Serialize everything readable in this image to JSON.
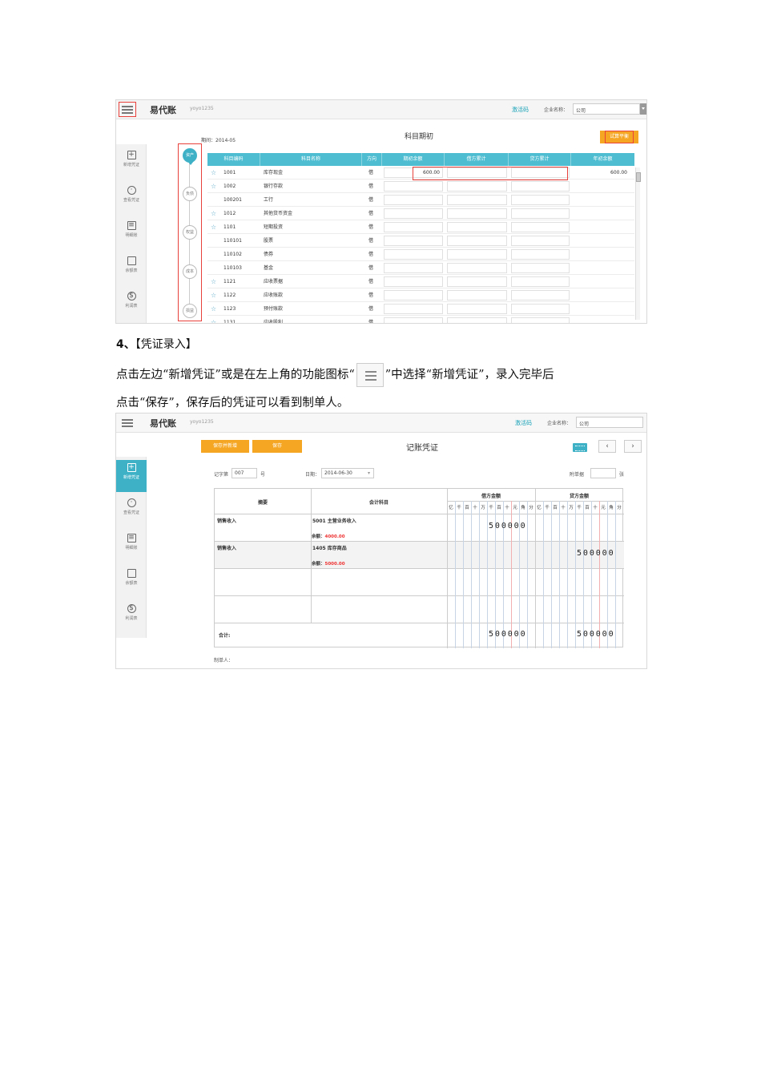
{
  "app": {
    "logo": "易代账",
    "user": "yoyo1235",
    "activate": "激活码",
    "company_label": "企业名称：",
    "company_value": "公司"
  },
  "sidebar": {
    "items": [
      {
        "label": "新增凭证",
        "icon": "plus-square-icon"
      },
      {
        "label": "查看凭证",
        "icon": "eye-icon"
      },
      {
        "label": "明细账",
        "icon": "document-icon"
      },
      {
        "label": "余额表",
        "icon": "clipboard-icon"
      },
      {
        "label": "利润表",
        "icon": "dollar-icon"
      }
    ]
  },
  "screen1": {
    "period": "期间：2014-05",
    "title": "科目期初",
    "trial_button": "试算平衡",
    "timeline": [
      "资产",
      "负债",
      "权益",
      "成本",
      "损益"
    ],
    "columns": [
      "科目编码",
      "科目名称",
      "方向",
      "期初余额",
      "借方累计",
      "贷方累计",
      "年初余额"
    ],
    "rows": [
      {
        "code": "1001",
        "name": "库存现金",
        "dir": "借",
        "star": true,
        "opening": "600.00",
        "year": "600.00"
      },
      {
        "code": "1002",
        "name": "银行存款",
        "dir": "借",
        "star": true,
        "opening": "",
        "year": ""
      },
      {
        "code": "100201",
        "name": "工行",
        "dir": "借",
        "star": false,
        "opening": "",
        "year": ""
      },
      {
        "code": "1012",
        "name": "其他货币资金",
        "dir": "借",
        "star": true,
        "opening": "",
        "year": ""
      },
      {
        "code": "1101",
        "name": "短期投资",
        "dir": "借",
        "star": true,
        "opening": "",
        "year": ""
      },
      {
        "code": "110101",
        "name": "股票",
        "dir": "借",
        "star": false,
        "opening": "",
        "year": ""
      },
      {
        "code": "110102",
        "name": "债券",
        "dir": "借",
        "star": false,
        "opening": "",
        "year": ""
      },
      {
        "code": "110103",
        "name": "基金",
        "dir": "借",
        "star": false,
        "opening": "",
        "year": ""
      },
      {
        "code": "1121",
        "name": "应收票据",
        "dir": "借",
        "star": true,
        "opening": "",
        "year": ""
      },
      {
        "code": "1122",
        "name": "应收账款",
        "dir": "借",
        "star": true,
        "opening": "",
        "year": ""
      },
      {
        "code": "1123",
        "name": "预付账款",
        "dir": "借",
        "star": true,
        "opening": "",
        "year": ""
      },
      {
        "code": "1131",
        "name": "应收股利",
        "dir": "借",
        "star": true,
        "opening": "",
        "year": ""
      }
    ]
  },
  "doc": {
    "heading_num": "4、",
    "heading_open": "【",
    "heading_text": "凭证录入",
    "heading_close": "】",
    "line1_before": "点击左边“新增凭证”或是在左上角的功能图标“",
    "line1_after": "”中选择“新增凭证”，录入完毕后",
    "line2": "点击“保存”，保存后的凭证可以看到制单人。"
  },
  "screen2": {
    "save_new": "保存并新增",
    "save": "保存",
    "title": "记账凭证",
    "prev": "‹",
    "next": "›",
    "voucher_word_label": "记字第",
    "voucher_no": "007",
    "hao": "号",
    "date_label": "日期：",
    "date_value": "2014-06-30",
    "attach_label": "附单据",
    "attach_unit": "张",
    "col_summary": "摘要",
    "col_account": "会计科目",
    "col_debit": "借方金额",
    "col_credit": "贷方金额",
    "units": [
      "亿",
      "千",
      "百",
      "十",
      "万",
      "千",
      "百",
      "十",
      "元",
      "角",
      "分"
    ],
    "entries": [
      {
        "summary": "销售收入",
        "account": "5001 主营业务收入",
        "balance_label": "余额：",
        "balance": "4000.00",
        "debit": "500000",
        "credit": ""
      },
      {
        "summary": "销售收入",
        "account": "1405 库存商品",
        "balance_label": "余额：",
        "balance": "5000.00",
        "debit": "",
        "credit": "500000"
      }
    ],
    "total_label": "合计:",
    "total_debit": "500000",
    "total_credit": "500000",
    "maker_label": "制单人："
  },
  "colors": {
    "accent": "#3fb1c7",
    "orange": "#f5a623",
    "highlight": "#e8413c"
  }
}
